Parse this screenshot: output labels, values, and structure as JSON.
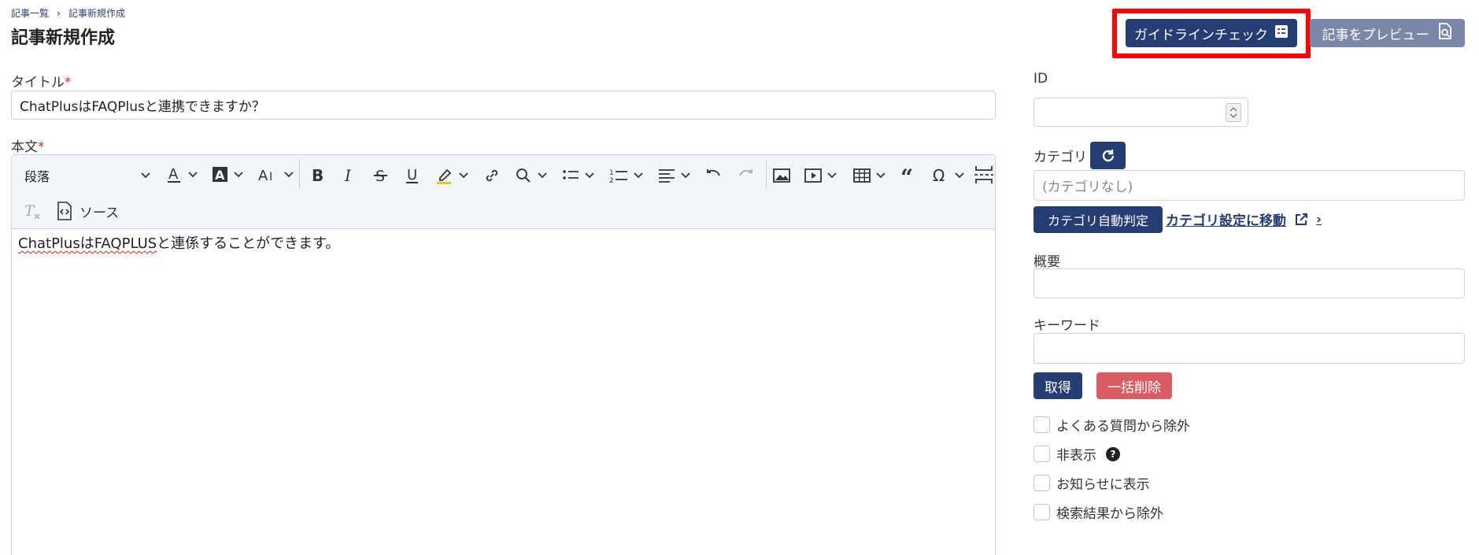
{
  "breadcrumb": {
    "items": [
      "記事一覧",
      "記事新規作成"
    ],
    "separator": "›"
  },
  "page_title": "記事新規作成",
  "header": {
    "guideline_check_label": "ガイドラインチェック",
    "preview_label": "記事をプレビュー"
  },
  "form": {
    "title_label": "タイトル",
    "title_value": "ChatPlusはFAQPlusと連携できますか？",
    "body_label": "本文",
    "required_mark": "*",
    "body_text_prefix": "ChatPlus",
    "body_text_middle": "はFAQPLUS",
    "body_text_suffix": "と連係することができます。",
    "toolbar": {
      "paragraph_select": "段落",
      "source_label": "ソース"
    }
  },
  "sidebar": {
    "id_label": "ID",
    "id_value": "",
    "category_label": "カテゴリ",
    "category_placeholder": "(カテゴリなし)",
    "auto_category_button": "カテゴリ自動判定",
    "category_settings_link": "カテゴリ設定に移動",
    "link_arrow": "›",
    "summary_label": "概要",
    "summary_value": "",
    "keyword_label": "キーワード",
    "keyword_value": "",
    "get_button": "取得",
    "bulk_delete_button": "一括削除",
    "checkboxes": [
      {
        "label": "よくある質問から除外",
        "checked": false
      },
      {
        "label": "非表示",
        "checked": false
      },
      {
        "label": "お知らせに表示",
        "checked": false
      },
      {
        "label": "検索結果から除外",
        "checked": false
      }
    ],
    "help_glyph": "?"
  },
  "colors": {
    "primary": "#263d73",
    "secondary": "#7a88a8",
    "danger": "#d95c63",
    "required": "#d9302c",
    "highlight_border": "#ff0000",
    "toolbar_bg": "#f2f5fa"
  }
}
